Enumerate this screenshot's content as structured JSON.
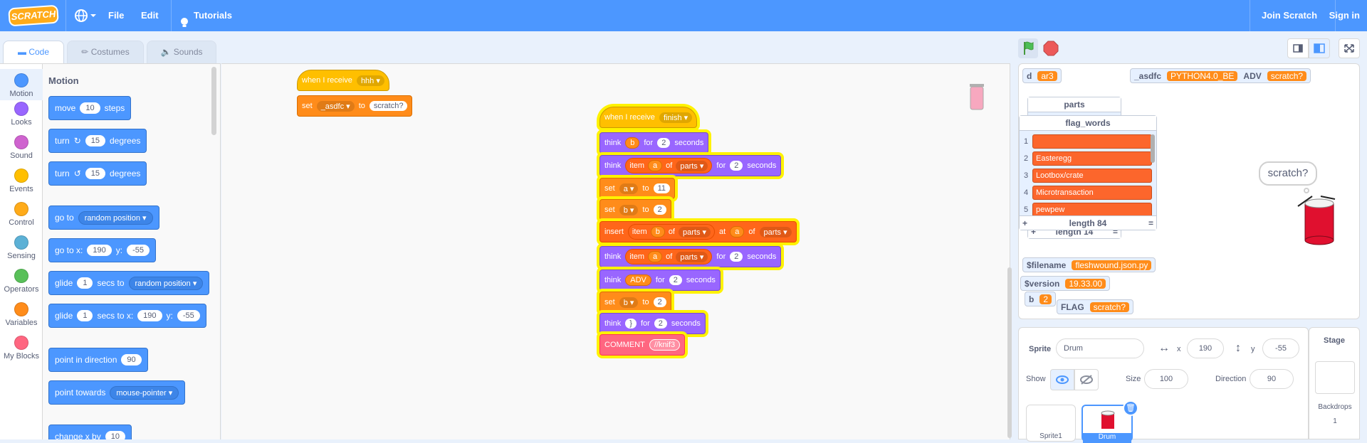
{
  "menubar": {
    "logo": "SCRATCH",
    "file": "File",
    "edit": "Edit",
    "tutorials": "Tutorials",
    "join": "Join Scratch",
    "signin": "Sign in"
  },
  "tabs": {
    "code": "Code",
    "costumes": "Costumes",
    "sounds": "Sounds"
  },
  "categories": [
    {
      "label": "Motion",
      "color": "#4c97ff"
    },
    {
      "label": "Looks",
      "color": "#9966ff"
    },
    {
      "label": "Sound",
      "color": "#cf63cf"
    },
    {
      "label": "Events",
      "color": "#ffbf00"
    },
    {
      "label": "Control",
      "color": "#ffab19"
    },
    {
      "label": "Sensing",
      "color": "#5cb1d6"
    },
    {
      "label": "Operators",
      "color": "#59c059"
    },
    {
      "label": "Variables",
      "color": "#ff8c1a"
    },
    {
      "label": "My Blocks",
      "color": "#ff6680"
    }
  ],
  "palette": {
    "title": "Motion",
    "move": {
      "a": "move",
      "v": "10",
      "b": "steps"
    },
    "turn_cw": {
      "a": "turn",
      "v": "15",
      "b": "degrees"
    },
    "turn_ccw": {
      "a": "turn",
      "v": "15",
      "b": "degrees"
    },
    "goto": {
      "a": "go to",
      "dd": "random position"
    },
    "gotoxy": {
      "a": "go to x:",
      "x": "190",
      "b": "y:",
      "y": "-55"
    },
    "glide1": {
      "a": "glide",
      "v": "1",
      "b": "secs to",
      "dd": "random position"
    },
    "glide2": {
      "a": "glide",
      "v": "1",
      "b": "secs to x:",
      "x": "190",
      "c": "y:",
      "y": "-55"
    },
    "point_dir": {
      "a": "point in direction",
      "v": "90"
    },
    "point_towards": {
      "a": "point towards",
      "dd": "mouse-pointer"
    },
    "change_x": {
      "a": "change x by",
      "v": "10"
    }
  },
  "script1": {
    "hat": {
      "a": "when I receive",
      "dd": "hhh"
    },
    "set": {
      "a": "set",
      "dd": "_asdfc",
      "b": "to",
      "v": "scratch?"
    }
  },
  "script2": {
    "hat": {
      "a": "when I receive",
      "dd": "finish"
    },
    "think1": {
      "a": "think",
      "r": "b",
      "b": "for",
      "v": "2",
      "c": "seconds"
    },
    "think2": {
      "a": "think",
      "item": "item",
      "idx": "a",
      "of": "of",
      "list": "parts",
      "b": "for",
      "v": "2",
      "c": "seconds"
    },
    "set_a": {
      "a": "set",
      "dd": "a",
      "b": "to",
      "v": "11"
    },
    "set_b1": {
      "a": "set",
      "dd": "b",
      "b": "to",
      "v": "2"
    },
    "insert": {
      "a": "insert",
      "item": "item",
      "idx": "b",
      "of": "of",
      "list": "parts",
      "at": "at",
      "pos": "a",
      "of2": "of",
      "list2": "parts"
    },
    "think3": {
      "a": "think",
      "item": "item",
      "idx": "a",
      "of": "of",
      "list": "parts",
      "b": "for",
      "v": "2",
      "c": "seconds"
    },
    "think4": {
      "a": "think",
      "r": "ADV",
      "b": "for",
      "v": "2",
      "c": "seconds"
    },
    "set_b2": {
      "a": "set",
      "dd": "b",
      "b": "to",
      "v": "2"
    },
    "think5": {
      "a": "think",
      "v0": "}",
      "b": "for",
      "v": "2",
      "c": "seconds"
    },
    "comment": {
      "a": "COMMENT",
      "v": "//knif3"
    }
  },
  "stage": {
    "monitors": {
      "d": {
        "name": "d",
        "value": "ar3"
      },
      "asdfc": {
        "name": "_asdfc",
        "value": "PYTHON4.0_BE"
      },
      "adv": {
        "name": "ADV",
        "value": "scratch?"
      },
      "parts_title": "parts",
      "parts_length": "length 14",
      "filename": {
        "name": "$filename",
        "value": "fleshwound.json.py"
      },
      "version": {
        "name": "$version",
        "value": "19.33.00"
      },
      "b": {
        "name": "b",
        "value": "2"
      },
      "flag": {
        "name": "FLAG",
        "value": "scratch?"
      }
    },
    "flag_words": {
      "title": "flag_words",
      "items": [
        {
          "idx": "1",
          "value": ""
        },
        {
          "idx": "2",
          "value": "Easteregg"
        },
        {
          "idx": "3",
          "value": "Lootbox/crate"
        },
        {
          "idx": "4",
          "value": "Microtransaction"
        },
        {
          "idx": "5",
          "value": "pewpew"
        }
      ],
      "plus": "+",
      "length": "length 84",
      "eq": "="
    },
    "bubble": "scratch?"
  },
  "sprite": {
    "label": "Sprite",
    "name": "Drum",
    "x_label": "x",
    "x": "190",
    "y_label": "y",
    "y": "-55",
    "show_label": "Show",
    "size_label": "Size",
    "size": "100",
    "direction_label": "Direction",
    "direction": "90",
    "thumb1": "Sprite1",
    "thumb2": "Drum"
  },
  "stagepanel": {
    "title": "Stage",
    "backdrops_label": "Backdrops",
    "backdrops": "1"
  }
}
